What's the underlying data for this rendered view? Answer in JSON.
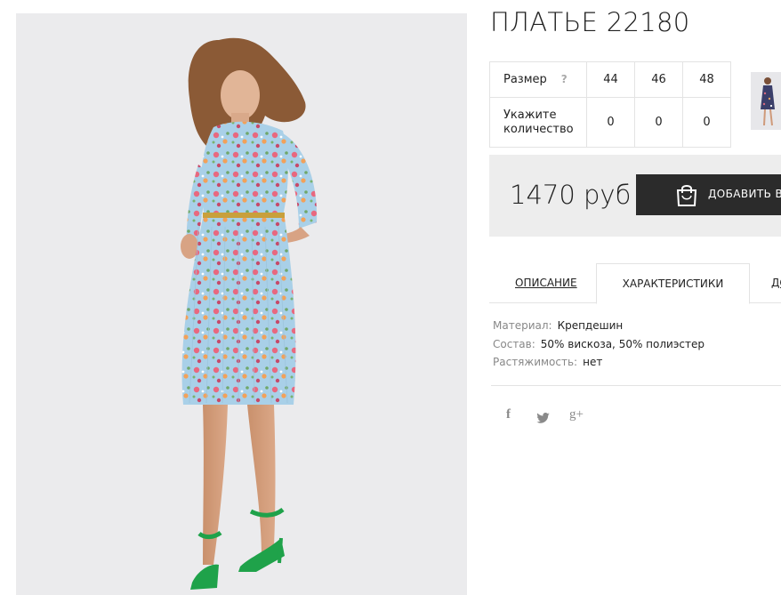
{
  "product": {
    "title": "ПЛАТЬЕ 22180",
    "price": "1470 руб",
    "image_alt": "Платье 22180"
  },
  "size_table": {
    "size_label": "Размер",
    "help_mark": "?",
    "sizes": [
      "44",
      "46",
      "48"
    ],
    "qty_label_line1": "Укажите",
    "qty_label_line2": "количество",
    "quantities": [
      "0",
      "0",
      "0"
    ]
  },
  "buy_button": {
    "label": "ДОБАВИТЬ В"
  },
  "tabs": {
    "description": "ОПИСАНИЕ",
    "characteristics": "ХАРАКТЕРИСТИКИ",
    "delivery": "ДО"
  },
  "characteristics": [
    {
      "key": "Материал:",
      "value": "Крепдешин"
    },
    {
      "key": "Состав:",
      "value": "50% вискоза, 50% полиэстер"
    },
    {
      "key": "Растяжимость:",
      "value": "нет"
    }
  ],
  "social": {
    "facebook": "f",
    "google_plus": "g+"
  },
  "colors": {
    "dress_blue": "#a8cfe6",
    "shoe_green": "#1fa24a",
    "button_dark": "#2b2b2b",
    "price_bg": "#ededed"
  }
}
